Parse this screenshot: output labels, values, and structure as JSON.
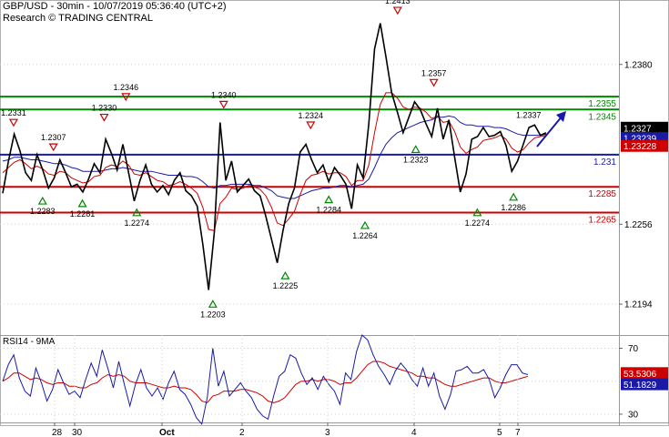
{
  "header": {
    "title": "GBP/USD - 30min - 10/07/2019 05:36:40 (UTC+2)",
    "subtitle": "Research © TRADING CENTRAL"
  },
  "chart_data": [
    {
      "type": "line",
      "name": "price",
      "ylim": [
        1.217,
        1.243
      ],
      "y_ticks": [
        "1.2380",
        "1.2256",
        "1.2194"
      ],
      "y_tick_values": [
        1.238,
        1.2256,
        1.2194
      ],
      "x_ticks": [
        "28",
        "30",
        "Oct",
        "2",
        "3",
        "4",
        "5",
        "7"
      ],
      "series": [
        {
          "color": "#000000",
          "values": [
            1.228,
            1.2305,
            1.2326,
            1.2313,
            1.2296,
            1.229,
            1.231,
            1.2298,
            1.2284,
            1.2292,
            1.2306,
            1.2296,
            1.2285,
            1.2287,
            1.2281,
            1.2291,
            1.2303,
            1.2296,
            1.2322,
            1.2311,
            1.2298,
            1.2318,
            1.2296,
            1.2274,
            1.229,
            1.2302,
            1.2287,
            1.2281,
            1.2286,
            1.2279,
            1.229,
            1.2296,
            1.2282,
            1.2278,
            1.227,
            1.224,
            1.2205,
            1.225,
            1.2335,
            1.229,
            1.2305,
            1.2281,
            1.2286,
            1.2291,
            1.2282,
            1.2278,
            1.2262,
            1.2244,
            1.2226,
            1.2251,
            1.2272,
            1.2284,
            1.2312,
            1.2318,
            1.2306,
            1.2296,
            1.2302,
            1.2289,
            1.23,
            1.2294,
            1.2287,
            1.2268,
            1.2302,
            1.2292,
            1.2334,
            1.2392,
            1.2412,
            1.2386,
            1.2358,
            1.2343,
            1.2327,
            1.2339,
            1.2351,
            1.2345,
            1.2334,
            1.2324,
            1.2346,
            1.2322,
            1.2337,
            1.2308,
            1.2281,
            1.2295,
            1.2322,
            1.2324,
            1.2331,
            1.2324,
            1.2325,
            1.2328,
            1.2317,
            1.2297,
            1.2305,
            1.2318,
            1.2331,
            1.2333,
            1.2325,
            1.2327
          ]
        },
        {
          "color": "#cc0000",
          "values": [
            1.2296,
            1.23,
            1.2304,
            1.2306,
            1.2303,
            1.2299,
            1.2301,
            1.2299,
            1.2295,
            1.2294,
            1.2297,
            1.2296,
            1.2292,
            1.229,
            1.2288,
            1.2289,
            1.2293,
            1.2294,
            1.23,
            1.2302,
            1.2301,
            1.2305,
            1.2302,
            1.2295,
            1.2294,
            1.2296,
            1.2293,
            1.229,
            1.2289,
            1.2286,
            1.2287,
            1.2289,
            1.2287,
            1.2284,
            1.228,
            1.2269,
            1.2252,
            1.2251,
            1.2272,
            1.2277,
            1.2284,
            1.2283,
            1.2284,
            1.2286,
            1.2285,
            1.2283,
            1.2278,
            1.2269,
            1.2257,
            1.2255,
            1.226,
            1.2266,
            1.2279,
            1.229,
            1.2294,
            1.2295,
            1.2297,
            1.2295,
            1.2296,
            1.2296,
            1.2293,
            1.2286,
            1.229,
            1.229,
            1.2302,
            1.2327,
            1.2349,
            1.2358,
            1.2358,
            1.2354,
            1.2347,
            1.2345,
            1.2347,
            1.2346,
            1.2343,
            1.2338,
            1.234,
            1.2335,
            1.2336,
            1.2328,
            1.2316,
            1.2311,
            1.2314,
            1.2316,
            1.2321,
            1.2322,
            1.2323,
            1.2325,
            1.2322,
            1.2315,
            1.2312,
            1.2314,
            1.2319,
            1.2323,
            1.2324,
            1.2325
          ]
        },
        {
          "color": "#1a1aa6",
          "values": [
            1.2305,
            1.2306,
            1.2308,
            1.2308,
            1.2307,
            1.2306,
            1.2306,
            1.2305,
            1.2304,
            1.2303,
            1.2303,
            1.2302,
            1.23,
            1.2299,
            1.2297,
            1.2297,
            1.2297,
            1.2297,
            1.2298,
            1.2299,
            1.2299,
            1.23,
            1.2299,
            1.2298,
            1.2297,
            1.2297,
            1.2297,
            1.2296,
            1.2295,
            1.2294,
            1.2294,
            1.2294,
            1.2293,
            1.2293,
            1.2292,
            1.2289,
            1.2285,
            1.2284,
            1.2286,
            1.2286,
            1.2287,
            1.2287,
            1.2287,
            1.2287,
            1.2286,
            1.2286,
            1.2284,
            1.2282,
            1.2278,
            1.2277,
            1.2276,
            1.2276,
            1.2278,
            1.228,
            1.2282,
            1.2283,
            1.2284,
            1.2284,
            1.2285,
            1.2286,
            1.2286,
            1.2285,
            1.2286,
            1.2287,
            1.2291,
            1.23,
            1.231,
            1.2318,
            1.2323,
            1.2327,
            1.2329,
            1.2331,
            1.2333,
            1.2335,
            1.2336,
            1.2337,
            1.2339,
            1.2339,
            1.234,
            1.2339,
            1.2335,
            1.2333,
            1.2333,
            1.2332,
            1.2332,
            1.2332,
            1.2331,
            1.2331,
            1.233,
            1.2328,
            1.2326,
            1.2325,
            1.2325,
            1.2325,
            1.2325,
            1.2326
          ]
        }
      ],
      "horizontal_levels": [
        {
          "value": 1.2355,
          "label": "1.2355",
          "color": "#008800"
        },
        {
          "value": 1.2345,
          "label": "1.2345",
          "color": "#008800"
        },
        {
          "value": 1.231,
          "label": "1.231",
          "color": "#1a1aa6"
        },
        {
          "value": 1.2285,
          "label": "1.2285",
          "color": "#cc0000"
        },
        {
          "value": 1.2265,
          "label": "1.2265",
          "color": "#cc0000"
        }
      ],
      "price_tags": [
        {
          "value": 1.2327,
          "label": "1.2327",
          "bg": "#000000",
          "fg": "#ffffff"
        },
        {
          "value": 1.23239,
          "label": "1.23239",
          "bg": "#1a1aa6",
          "fg": "#ffffff"
        },
        {
          "value": 1.23228,
          "label": "1.23228",
          "bg": "#cc0000",
          "fg": "#ffffff"
        }
      ],
      "peak_markers": [
        {
          "label": "1.2331",
          "kind": "high",
          "i": 3,
          "value": 1.2326
        },
        {
          "label": "1.2307",
          "kind": "high",
          "i": 14,
          "value": 1.2307
        },
        {
          "label": "1.2330",
          "kind": "high",
          "i": 28,
          "value": 1.233
        },
        {
          "label": "1.2346",
          "kind": "high",
          "i": 34,
          "value": 1.2346
        },
        {
          "label": "1.2340",
          "kind": "high",
          "i": 61,
          "value": 1.234
        },
        {
          "label": "1.2324",
          "kind": "high",
          "i": 85,
          "value": 1.2324
        },
        {
          "label": "1.2413",
          "kind": "high",
          "i": 109,
          "value": 1.2413
        },
        {
          "label": "1.2357",
          "kind": "high",
          "i": 119,
          "value": 1.2357
        },
        {
          "label": "1.2283",
          "kind": "low",
          "i": 11,
          "value": 1.2283
        },
        {
          "label": "1.2281",
          "kind": "low",
          "i": 22,
          "value": 1.2281
        },
        {
          "label": "1.2274",
          "kind": "low",
          "i": 37,
          "value": 1.2274
        },
        {
          "label": "1.2203",
          "kind": "low",
          "i": 58,
          "value": 1.2203
        },
        {
          "label": "1.2225",
          "kind": "low",
          "i": 78,
          "value": 1.2225
        },
        {
          "label": "1.2284",
          "kind": "low",
          "i": 90,
          "value": 1.2284
        },
        {
          "label": "1.2264",
          "kind": "low",
          "i": 100,
          "value": 1.2264
        },
        {
          "label": "1.2323",
          "kind": "low",
          "i": 114,
          "value": 1.2323
        },
        {
          "label": "1.2274",
          "kind": "low",
          "i": 131,
          "value": 1.2274
        },
        {
          "label": "1.2286",
          "kind": "low",
          "i": 141,
          "value": 1.2286
        }
      ],
      "annotations": [
        {
          "label": "1.2337",
          "value": 1.2337,
          "color": "#000000"
        }
      ],
      "projection_arrow": {
        "color": "#1a1aa6",
        "direction": "up"
      }
    },
    {
      "type": "line",
      "name": "rsi",
      "title": "RSI14 - 9MA",
      "ylim": [
        25,
        78
      ],
      "y_ticks": [
        "70",
        "30"
      ],
      "y_tick_values": [
        70,
        30
      ],
      "series": [
        {
          "color": "#1a1aa6",
          "values": [
            50,
            60,
            66,
            52,
            44,
            41,
            58,
            49,
            38,
            45,
            57,
            49,
            42,
            44,
            40,
            51,
            61,
            53,
            69,
            58,
            46,
            62,
            48,
            35,
            48,
            57,
            46,
            41,
            46,
            39,
            49,
            56,
            45,
            42,
            36,
            28,
            24,
            40,
            70,
            47,
            56,
            41,
            45,
            49,
            44,
            40,
            33,
            29,
            27,
            41,
            53,
            56,
            66,
            64,
            55,
            48,
            52,
            45,
            53,
            48,
            44,
            36,
            55,
            51,
            68,
            78,
            75,
            66,
            59,
            54,
            48,
            56,
            61,
            57,
            51,
            47,
            58,
            47,
            55,
            41,
            33,
            42,
            56,
            57,
            59,
            55,
            55,
            57,
            51,
            40,
            46,
            54,
            60,
            60,
            55,
            54
          ]
        },
        {
          "color": "#cc0000",
          "values": [
            50,
            52,
            55,
            55,
            53,
            51,
            52,
            51,
            49,
            48,
            49,
            49,
            47,
            47,
            46,
            46,
            48,
            49,
            52,
            54,
            53,
            54,
            53,
            50,
            49,
            49,
            49,
            48,
            47,
            46,
            46,
            47,
            46,
            46,
            45,
            42,
            38,
            37,
            41,
            42,
            44,
            44,
            44,
            45,
            45,
            44,
            43,
            41,
            38,
            37,
            38,
            40,
            44,
            48,
            50,
            50,
            51,
            50,
            51,
            51,
            50,
            48,
            49,
            49,
            52,
            56,
            60,
            62,
            62,
            61,
            59,
            58,
            57,
            56,
            55,
            53,
            53,
            52,
            52,
            50,
            48,
            47,
            47,
            48,
            49,
            50,
            51,
            52,
            52,
            50,
            49,
            49,
            50,
            51,
            52,
            53
          ]
        }
      ],
      "price_tags": [
        {
          "value": 53.5306,
          "label": "53.5306",
          "bg": "#cc0000",
          "fg": "#ffffff"
        },
        {
          "value": 51.1829,
          "label": "51.1829",
          "bg": "#1a1aa6",
          "fg": "#ffffff"
        }
      ]
    }
  ]
}
